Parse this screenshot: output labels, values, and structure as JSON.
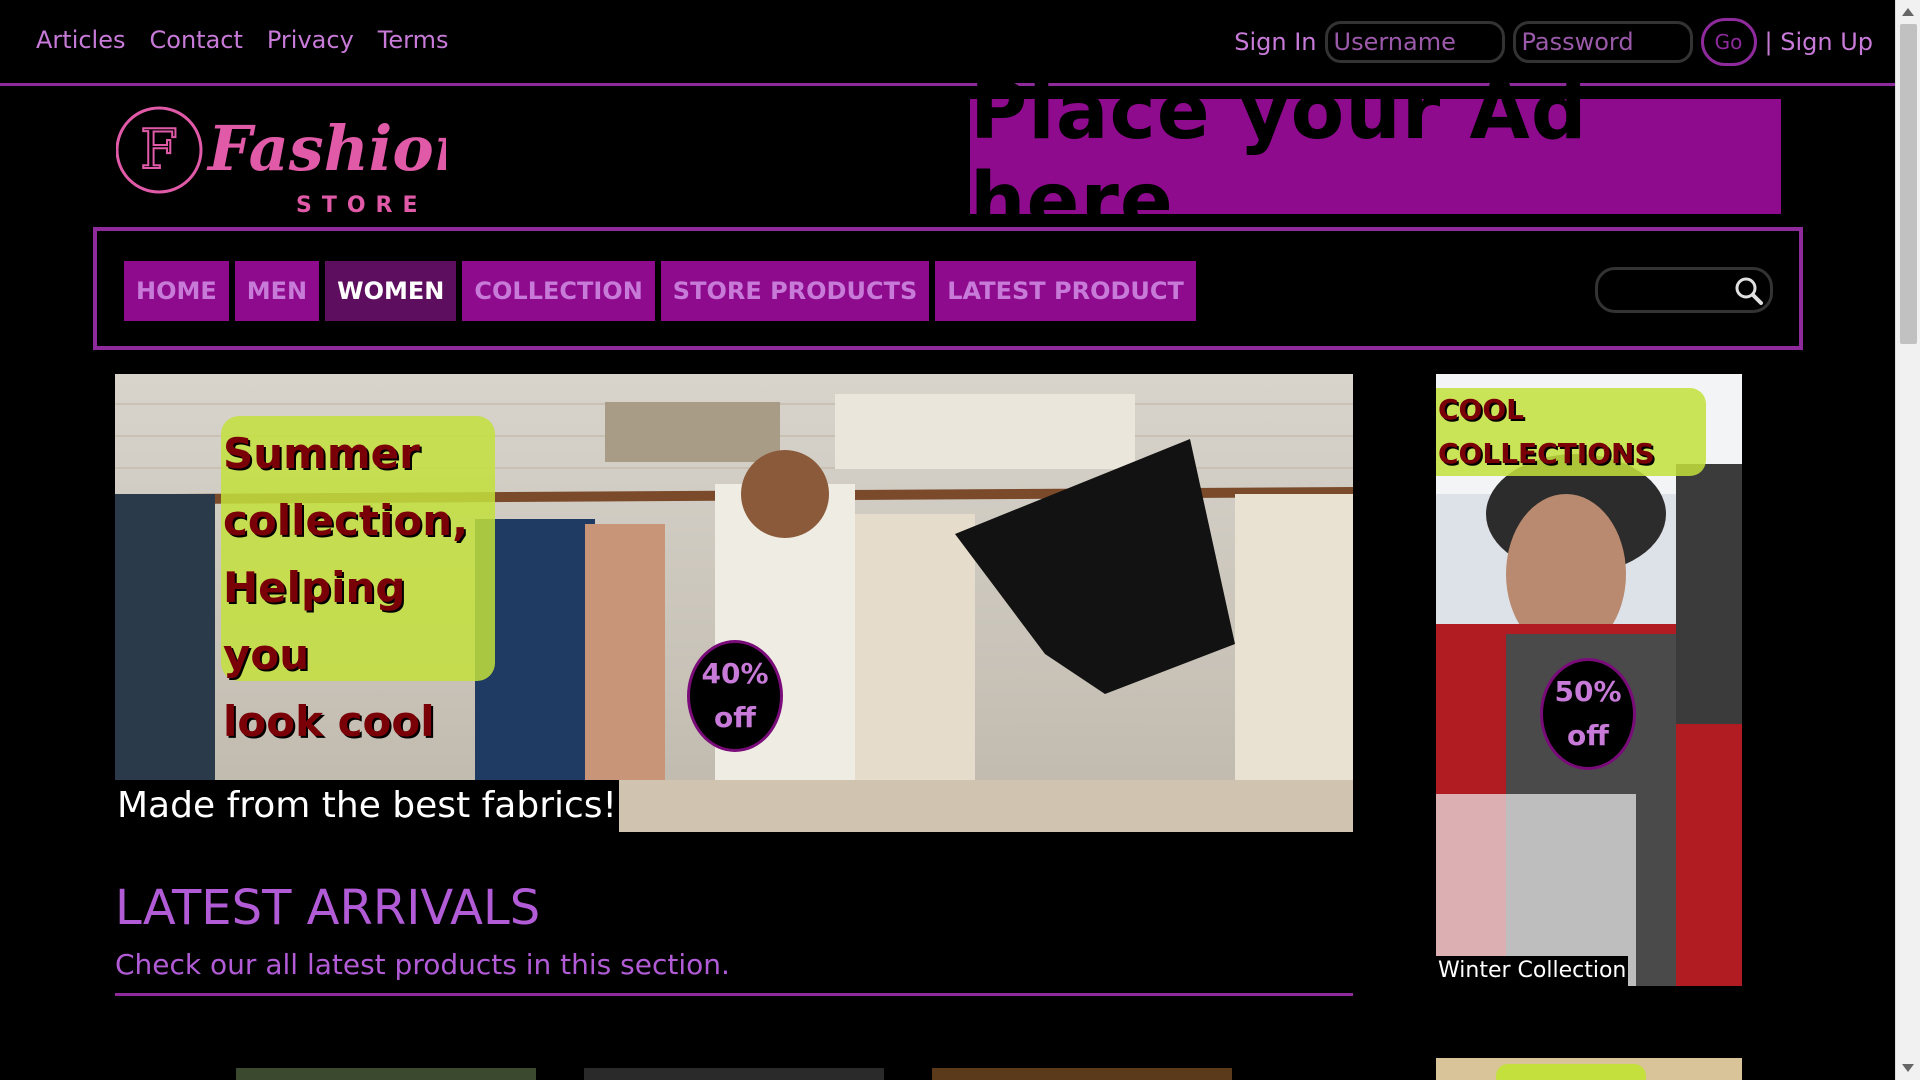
{
  "top_links": [
    "Articles",
    "Contact",
    "Privacy",
    "Terms"
  ],
  "auth": {
    "signin_label": "Sign In",
    "username_placeholder": "Username",
    "password_placeholder": "Password",
    "go_label": "Go",
    "signup_label": "| Sign Up"
  },
  "logo": {
    "letter": "F",
    "word": "Fashion",
    "sub": "STORE"
  },
  "ad": {
    "text": "Place your Ad here"
  },
  "nav": {
    "items": [
      "HOME",
      "MEN",
      "WOMEN",
      "COLLECTION",
      "STORE PRODUCTS",
      "LATEST PRODUCT"
    ],
    "active": "WOMEN"
  },
  "hero": {
    "headline_lines": [
      "Summer",
      "collection,",
      "Helping you",
      "look cool"
    ],
    "badge_lines": [
      "40%",
      "off"
    ],
    "caption": "Made from the best fabrics!"
  },
  "side": {
    "tag_lines": [
      "COOL",
      "COLLECTIONS"
    ],
    "badge_lines": [
      "50%",
      "off"
    ],
    "caption": "Winter Collection"
  },
  "arrivals": {
    "title": "LATEST ARRIVALS",
    "subtitle": "Check our all latest products in this section."
  },
  "colors": {
    "accent": "#8e0b8e",
    "link": "#c77ad8",
    "highlight": "#c3e03c",
    "headline_text": "#7a0008"
  }
}
